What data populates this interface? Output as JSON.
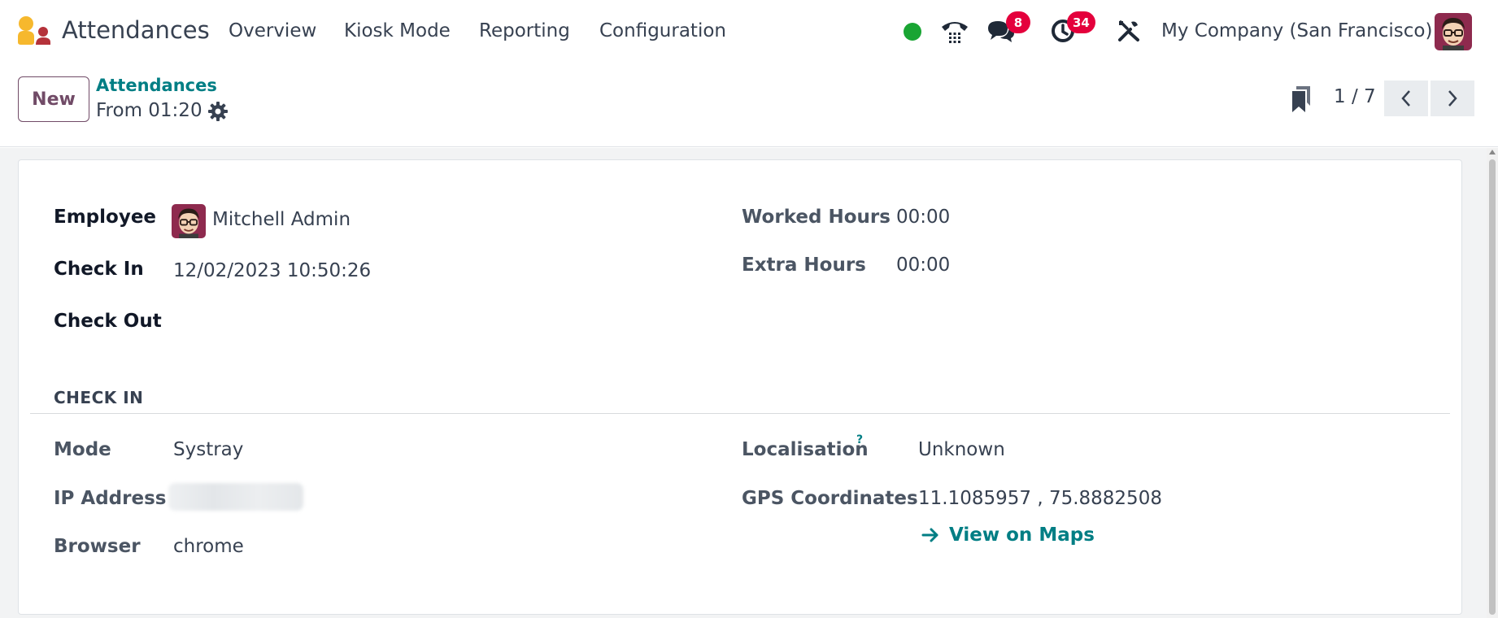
{
  "navbar": {
    "app_title": "Attendances",
    "menu": [
      "Overview",
      "Kiosk Mode",
      "Reporting",
      "Configuration"
    ],
    "status_color": "#19a533",
    "messages_badge": "8",
    "activities_badge": "34",
    "company": "My Company (San Francisco)",
    "badge_color": "#e4003c"
  },
  "control_panel": {
    "new_label": "New",
    "breadcrumb_parent": "Attendances",
    "breadcrumb_current": "From 01:20",
    "pager_value": "1 / 7"
  },
  "form": {
    "employee_label": "Employee",
    "employee_value": "Mitchell Admin",
    "check_in_label": "Check In",
    "check_in_value": "12/02/2023 10:50:26",
    "check_out_label": "Check Out",
    "check_out_value": "",
    "worked_hours_label": "Worked Hours",
    "worked_hours_value": "00:00",
    "extra_hours_label": "Extra Hours",
    "extra_hours_value": "00:00",
    "section_title": "CHECK IN",
    "mode_label": "Mode",
    "mode_value": "Systray",
    "ip_label": "IP Address",
    "browser_label": "Browser",
    "browser_value": "chrome",
    "localisation_label": "Localisation",
    "localisation_help": "?",
    "localisation_value": "Unknown",
    "gps_label": "GPS Coordinates",
    "gps_value": "11.1085957 , 75.8882508",
    "view_maps_label": "View on Maps"
  },
  "colors": {
    "brand": "#714b67",
    "link": "#017e84"
  }
}
